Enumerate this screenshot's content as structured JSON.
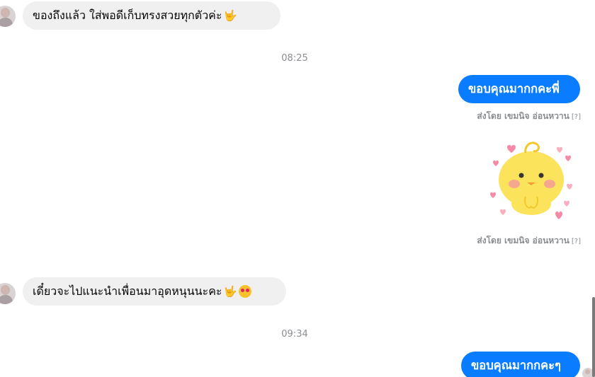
{
  "messages": [
    {
      "type": "incoming",
      "text": "ของถึงแล้ว ใส่พอดีเก็บทรงสวยทุกตัวค่ะ",
      "emoji": "🤟"
    },
    {
      "type": "time",
      "text": "08:25"
    },
    {
      "type": "outgoing",
      "text": "ขอบคุณมากกคะพี่",
      "sent_by": "ส่งโดย เขมนิจ อ่อนหวาน",
      "sent_by_q": "[?]"
    },
    {
      "type": "sticker",
      "icon": "yellow-chick-sticker-with-hearts",
      "sent_by": "ส่งโดย เขมนิจ อ่อนหวาน",
      "sent_by_q": "[?]"
    },
    {
      "type": "incoming",
      "text": "เดี๋ยวจะไปแนะนำเพื่อนมาอุดหนุนนะคะ",
      "emoji": "🤟",
      "emoji2": "heart-eyes-emoji"
    },
    {
      "type": "time",
      "text": "09:34"
    },
    {
      "type": "outgoing",
      "text": "ขอบคุณมากกคะๆ"
    }
  ],
  "colors": {
    "outgoing_bubble": "#0a7cff",
    "incoming_bubble": "#f0f0f0",
    "timestamp": "#8a8d91"
  }
}
